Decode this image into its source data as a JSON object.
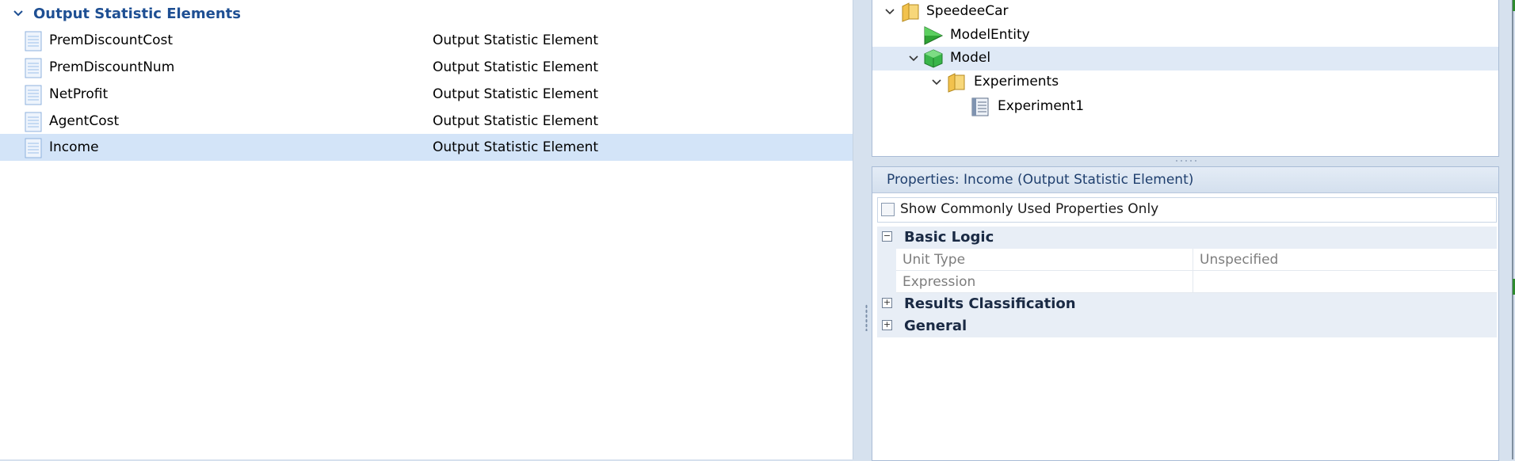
{
  "left_panel": {
    "group_title": "Output Statistic Elements",
    "rows": [
      {
        "name": "PremDiscountCost",
        "type": "Output Statistic Element"
      },
      {
        "name": "PremDiscountNum",
        "type": "Output Statistic Element"
      },
      {
        "name": "NetProfit",
        "type": "Output Statistic Element"
      },
      {
        "name": "AgentCost",
        "type": "Output Statistic Element"
      },
      {
        "name": "Income",
        "type": "Output Statistic Element"
      }
    ],
    "selected_row": "Income"
  },
  "tree": {
    "items": [
      {
        "label": "SpeedeeCar",
        "icon": "folder-icon"
      },
      {
        "label": "ModelEntity",
        "icon": "entity-icon"
      },
      {
        "label": "Model",
        "icon": "model-cube-icon"
      },
      {
        "label": "Experiments",
        "icon": "folder-icon"
      },
      {
        "label": "Experiment1",
        "icon": "experiment-icon"
      }
    ],
    "selected": "Model"
  },
  "properties": {
    "title": "Properties: Income (Output Statistic Element)",
    "show_common_label": "Show Commonly Used Properties Only",
    "show_common_checked": false,
    "categories": [
      {
        "label": "Basic Logic",
        "expanded": true,
        "properties": [
          {
            "name": "Unit Type",
            "value": "Unspecified"
          },
          {
            "name": "Expression",
            "value": ""
          }
        ]
      },
      {
        "label": "Results Classification",
        "expanded": false
      },
      {
        "label": "General",
        "expanded": false
      }
    ]
  },
  "colors": {
    "group_title": "#1e4f93",
    "selection": "#d3e4f8",
    "panel_border": "#a9bcd6"
  }
}
